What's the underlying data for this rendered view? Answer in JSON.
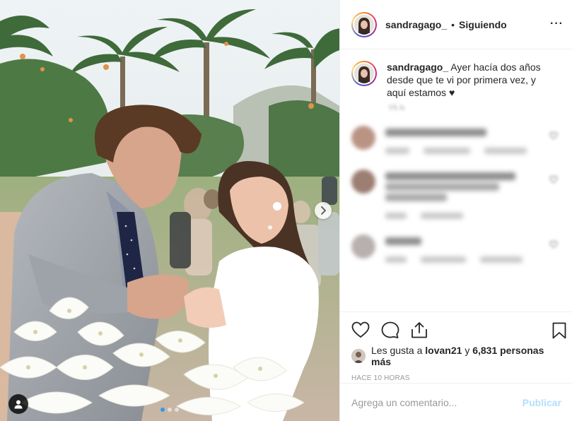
{
  "post": {
    "username": "sandragago_",
    "separator": "•",
    "follow_status": "Siguiendo",
    "more_label": "···",
    "caption_user": "sandragago_",
    "caption_text": "Ayer hacía dos años desde que te vi por primera vez, y aquí estamos",
    "caption_heart": "♥",
    "caption_time_blurred": "15 h"
  },
  "comments": [
    {
      "blurred": true,
      "avatar_color": "#b99484",
      "line_widths_pct": [
        62
      ],
      "meta_widths": [
        34,
        66,
        60
      ],
      "heart_color": "#e0505a",
      "emoji_color": "#4a90e2"
    },
    {
      "blurred": true,
      "avatar_color": "#9c7e72",
      "line_widths_pct": [
        80,
        70,
        38
      ],
      "meta_widths": [
        30,
        60
      ],
      "heart_color": "#f0c040",
      "emoji_color": "#4a90e2"
    },
    {
      "blurred": true,
      "avatar_color": "#b8b0ae",
      "line_widths_pct": [
        22
      ],
      "meta_widths": [
        30,
        64,
        60
      ],
      "heart_color": "#e0505a",
      "emoji_color": "#4a90e2"
    }
  ],
  "actions": {
    "like": "heart-outline",
    "comment": "speech-bubble",
    "share": "share-upload",
    "save": "bookmark"
  },
  "likes": {
    "prefix": "Les gusta a",
    "user": "lovan21",
    "connector": "y",
    "count": "6,831 personas más"
  },
  "posted_time": "HACE 10 HORAS",
  "add_comment": {
    "placeholder": "Agrega un comentario...",
    "publish_label": "Publicar"
  },
  "carousel": {
    "total": 3,
    "active_index": 0
  },
  "colors": {
    "link_blue": "#3897f0",
    "publish_disabled": "#b2dffc",
    "muted": "#999999"
  }
}
